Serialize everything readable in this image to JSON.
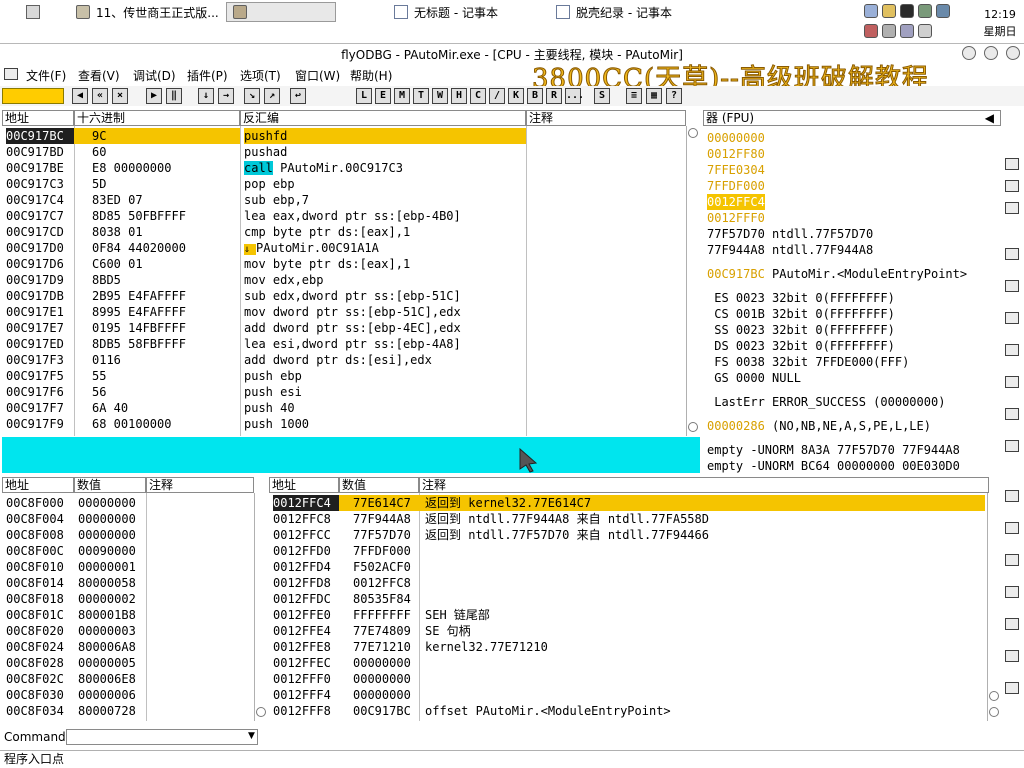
{
  "taskbar": {
    "items": [
      {
        "label": "11、传世商王正式版..."
      },
      {
        "label": ""
      },
      {
        "label": "无标题 - 记事本"
      },
      {
        "label": "脱壳纪录 - 记事本"
      }
    ],
    "clock": {
      "time": "12:19",
      "day": "星期日"
    }
  },
  "window": {
    "title": "flyODBG - PAutoMir.exe - [CPU - 主要线程, 模块 - PAutoMir]",
    "watermark": "3800CC(天草)--高级班破解教程"
  },
  "menu": [
    "文件(F)",
    "查看(V)",
    "调试(D)",
    "插件(P)",
    "选项(T)",
    "窗口(W)",
    "帮助(H)"
  ],
  "toolbar": {
    "letters": [
      "L",
      "E",
      "M",
      "T",
      "W",
      "H",
      "C",
      "/",
      "K",
      "B",
      "R",
      "...",
      "S"
    ]
  },
  "disasm": {
    "headers": {
      "addr": "地址",
      "hex": "十六进制",
      "code": "反汇编",
      "comment": "注释"
    },
    "rows": [
      {
        "addr": "00C917BC",
        "hex": "9C",
        "code": "pushfd"
      },
      {
        "addr": "00C917BD",
        "hex": "60",
        "code": "pushad"
      },
      {
        "addr": "00C917BE",
        "hex": "E8 00000000",
        "code": "call PAutoMir.00C917C3",
        "code_kw": "call",
        "code_rest": " PAutoMir.00C917C3"
      },
      {
        "addr": "00C917C3",
        "hex": "5D",
        "code": "pop ebp"
      },
      {
        "addr": "00C917C4",
        "hex": "83ED 07",
        "code": "sub ebp,7"
      },
      {
        "addr": "00C917C7",
        "hex": "8D85 50FBFFFF",
        "code": "lea eax,dword ptr ss:[ebp-4B0]"
      },
      {
        "addr": "00C917CD",
        "hex": "8038 01",
        "code": "cmp byte ptr ds:[eax],1"
      },
      {
        "addr": "00C917D0",
        "hex": "0F84 44020000",
        "code": "PAutoMir.00C91A1A",
        "code_mark": "je"
      },
      {
        "addr": "00C917D6",
        "hex": "C600 01",
        "code": "mov byte ptr ds:[eax],1"
      },
      {
        "addr": "00C917D9",
        "hex": "8BD5",
        "code": "mov edx,ebp"
      },
      {
        "addr": "00C917DB",
        "hex": "2B95 E4FAFFFF",
        "code": "sub edx,dword ptr ss:[ebp-51C]"
      },
      {
        "addr": "00C917E1",
        "hex": "8995 E4FAFFFF",
        "code": "mov dword ptr ss:[ebp-51C],edx"
      },
      {
        "addr": "00C917E7",
        "hex": "0195 14FBFFFF",
        "code": "add dword ptr ss:[ebp-4EC],edx"
      },
      {
        "addr": "00C917ED",
        "hex": "8DB5 58FBFFFF",
        "code": "lea esi,dword ptr ss:[ebp-4A8]"
      },
      {
        "addr": "00C917F3",
        "hex": "0116",
        "code": "add dword ptr ds:[esi],edx"
      },
      {
        "addr": "00C917F5",
        "hex": "55",
        "code": "push ebp"
      },
      {
        "addr": "00C917F6",
        "hex": "56",
        "code": "push esi"
      },
      {
        "addr": "00C917F7",
        "hex": "6A 40",
        "code": "push 40"
      },
      {
        "addr": "00C917F9",
        "hex": "68 00100000",
        "code": "push 1000"
      }
    ]
  },
  "registers": {
    "header": "器 (FPU)",
    "stack_vals": [
      "00000000",
      "0012FF80",
      "7FFE0304",
      "7FFDF000",
      "0012FFC4",
      "0012FFF0"
    ],
    "lines": [
      "77F57D70 ntdll.77F57D70",
      "77F944A8 ntdll.77F944A8",
      "",
      "00C917BC PAutoMir.<ModuleEntryPoint>",
      "",
      " ES 0023 32bit 0(FFFFFFFF)",
      " CS 001B 32bit 0(FFFFFFFF)",
      " SS 0023 32bit 0(FFFFFFFF)",
      " DS 0023 32bit 0(FFFFFFFF)",
      " FS 0038 32bit 7FFDE000(FFF)",
      " GS 0000 NULL",
      "",
      " LastErr ERROR_SUCCESS (00000000)",
      "",
      "00000286 (NO,NB,NE,A,S,PE,L,LE)",
      "",
      "empty -UNORM 8A3A 77F57D70 77F944A8",
      "empty -UNORM BC64 00000000 00E030D0"
    ]
  },
  "dump": {
    "headers": {
      "addr": "地址",
      "value": "数值",
      "comment": "注释"
    },
    "rows": [
      {
        "addr": "00C8F000",
        "value": "00000000"
      },
      {
        "addr": "00C8F004",
        "value": "00000000"
      },
      {
        "addr": "00C8F008",
        "value": "00000000"
      },
      {
        "addr": "00C8F00C",
        "value": "00090000"
      },
      {
        "addr": "00C8F010",
        "value": "00000001"
      },
      {
        "addr": "00C8F014",
        "value": "80000058"
      },
      {
        "addr": "00C8F018",
        "value": "00000002"
      },
      {
        "addr": "00C8F01C",
        "value": "800001B8"
      },
      {
        "addr": "00C8F020",
        "value": "00000003"
      },
      {
        "addr": "00C8F024",
        "value": "800006A8"
      },
      {
        "addr": "00C8F028",
        "value": "00000005"
      },
      {
        "addr": "00C8F02C",
        "value": "800006E8"
      },
      {
        "addr": "00C8F030",
        "value": "00000006"
      },
      {
        "addr": "00C8F034",
        "value": "80000728"
      }
    ]
  },
  "stack": {
    "headers": {
      "addr": "地址",
      "value": "数值",
      "comment": "注释"
    },
    "rows": [
      {
        "addr": "0012FFC4",
        "value": "77E614C7",
        "comment": "返回到 kernel32.77E614C7"
      },
      {
        "addr": "0012FFC8",
        "value": "77F944A8",
        "comment": "返回到 ntdll.77F944A8 来自 ntdll.77FA558D"
      },
      {
        "addr": "0012FFCC",
        "value": "77F57D70",
        "comment": "返回到 ntdll.77F57D70 来自 ntdll.77F94466"
      },
      {
        "addr": "0012FFD0",
        "value": "7FFDF000",
        "comment": ""
      },
      {
        "addr": "0012FFD4",
        "value": "F502ACF0",
        "comment": ""
      },
      {
        "addr": "0012FFD8",
        "value": "0012FFC8",
        "comment": ""
      },
      {
        "addr": "0012FFDC",
        "value": "80535F84",
        "comment": ""
      },
      {
        "addr": "0012FFE0",
        "value": "FFFFFFFF",
        "comment": "SEH 链尾部"
      },
      {
        "addr": "0012FFE4",
        "value": "77E74809",
        "comment": "SE 句柄"
      },
      {
        "addr": "0012FFE8",
        "value": "77E71210",
        "comment": "kernel32.77E71210"
      },
      {
        "addr": "0012FFEC",
        "value": "00000000",
        "comment": ""
      },
      {
        "addr": "0012FFF0",
        "value": "00000000",
        "comment": ""
      },
      {
        "addr": "0012FFF4",
        "value": "00000000",
        "comment": ""
      },
      {
        "addr": "0012FFF8",
        "value": "00C917BC",
        "comment": "offset PAutoMir.<ModuleEntryPoint>"
      }
    ]
  },
  "command": {
    "label": "Command",
    "value": ""
  },
  "status": {
    "text": "程序入口点"
  },
  "colors": {
    "highlight": "#f5c400",
    "info_pane": "#00e5ee",
    "watermark": "#f0b81c"
  }
}
